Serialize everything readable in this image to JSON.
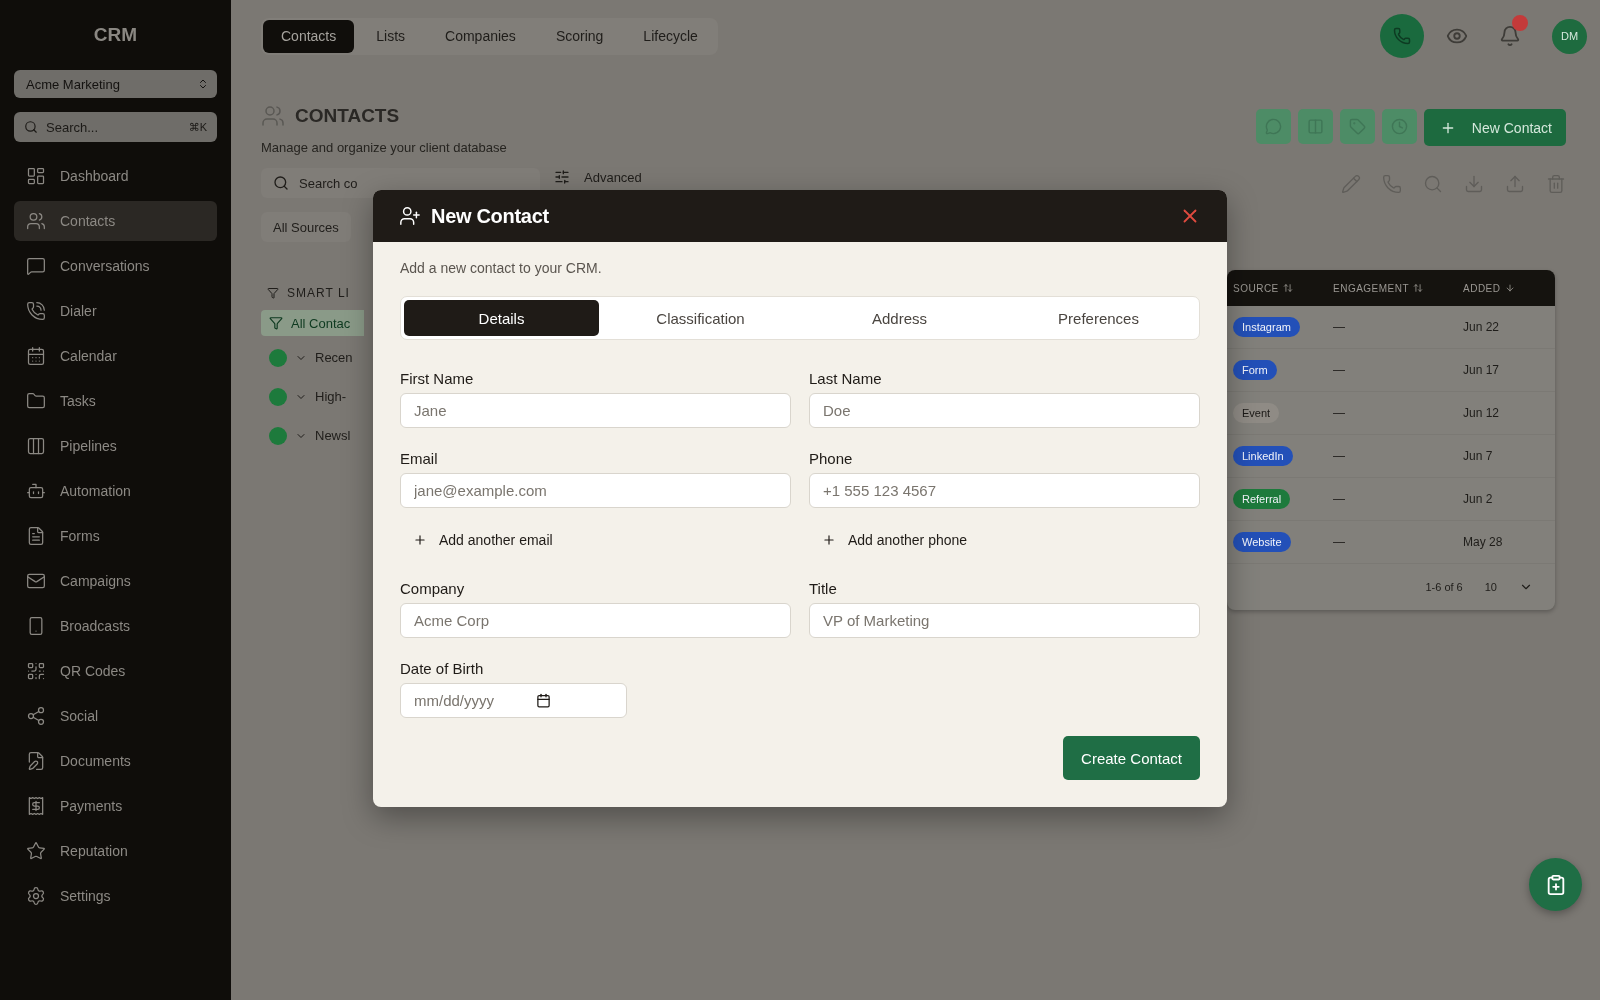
{
  "sidebar": {
    "logo": "CRM",
    "workspace": "Acme Marketing",
    "search": {
      "placeholder": "Search...",
      "shortcut": "⌘K"
    },
    "items": [
      {
        "label": "Dashboard",
        "selected": false
      },
      {
        "label": "Contacts",
        "selected": true
      },
      {
        "label": "Conversations",
        "selected": false
      },
      {
        "label": "Dialer",
        "selected": false
      },
      {
        "label": "Calendar",
        "selected": false
      },
      {
        "label": "Tasks",
        "selected": false
      },
      {
        "label": "Pipelines",
        "selected": false
      },
      {
        "label": "Automation",
        "selected": false
      },
      {
        "label": "Forms",
        "selected": false
      },
      {
        "label": "Campaigns",
        "selected": false
      },
      {
        "label": "Broadcasts",
        "selected": false
      },
      {
        "label": "QR Codes",
        "selected": false
      },
      {
        "label": "Social",
        "selected": false
      },
      {
        "label": "Documents",
        "selected": false
      },
      {
        "label": "Payments",
        "selected": false
      },
      {
        "label": "Reputation",
        "selected": false
      },
      {
        "label": "Settings",
        "selected": false
      }
    ]
  },
  "top_tabs": [
    {
      "label": "Contacts",
      "selected": true
    },
    {
      "label": "Lists",
      "selected": false
    },
    {
      "label": "Companies",
      "selected": false
    },
    {
      "label": "Scoring",
      "selected": false
    },
    {
      "label": "Lifecycle",
      "selected": false
    }
  ],
  "user": {
    "initials": "DM",
    "unread_notifications": true
  },
  "header": {
    "title": "CONTACTS",
    "subtitle": "Manage and organize your client database",
    "new_button": "New Contact"
  },
  "toolbar": {
    "search_placeholder": "Search co",
    "advanced": "Advanced",
    "source_filter": "All Sources"
  },
  "smart_lists": {
    "title": "SMART LI",
    "items": [
      {
        "label": "All Contac",
        "selected": true
      },
      {
        "label": "Recen",
        "selected": false
      },
      {
        "label": "High-",
        "selected": false
      },
      {
        "label": "Newsl",
        "selected": false
      }
    ]
  },
  "table": {
    "columns": [
      "SOURCE",
      "ENGAGEMENT",
      "ADDED"
    ],
    "rows": [
      {
        "source": "Instagram",
        "color": "#2350b8",
        "engagement": "—",
        "added": "Jun 22"
      },
      {
        "source": "Form",
        "color": "#2350b8",
        "engagement": "—",
        "added": "Jun 17"
      },
      {
        "source": "Event",
        "color": "#8f8b85",
        "engagement": "—",
        "added": "Jun 12"
      },
      {
        "source": "LinkedIn",
        "color": "#2350b8",
        "engagement": "—",
        "added": "Jun 7"
      },
      {
        "source": "Referral",
        "color": "#1d7a3c",
        "engagement": "—",
        "added": "Jun 2"
      },
      {
        "source": "Website",
        "color": "#2350b8",
        "engagement": "—",
        "added": "May 28"
      }
    ],
    "range": "1-6 of 6",
    "per_page": "10"
  },
  "modal": {
    "title": "New Contact",
    "description": "Add a new contact to your CRM.",
    "tabs": [
      {
        "label": "Details",
        "selected": true
      },
      {
        "label": "Classification",
        "selected": false
      },
      {
        "label": "Address",
        "selected": false
      },
      {
        "label": "Preferences",
        "selected": false
      }
    ],
    "fields": [
      {
        "label": "First Name",
        "placeholder": "Jane"
      },
      {
        "label": "Last Name",
        "placeholder": "Doe"
      },
      {
        "label": "Email",
        "placeholder": "jane@example.com",
        "add_link": "Add another email"
      },
      {
        "label": "Phone",
        "placeholder": "+1 555 123 4567",
        "add_link": "Add another phone"
      },
      {
        "label": "Company",
        "placeholder": "Acme Corp"
      },
      {
        "label": "Title",
        "placeholder": "VP of Marketing"
      }
    ],
    "date_field": {
      "label": "Date of Birth",
      "placeholder": "mm/dd/yyyy"
    },
    "submit": "Create Contact"
  }
}
